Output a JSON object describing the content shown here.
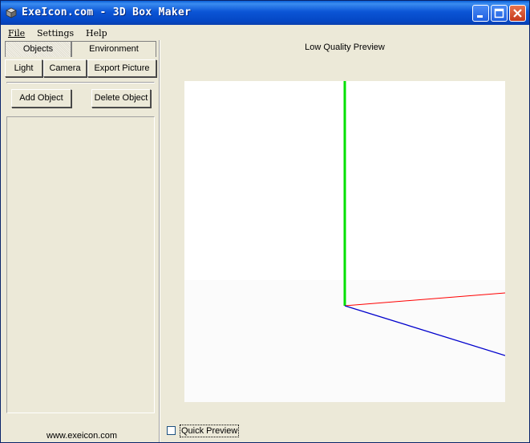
{
  "window": {
    "title": "ExeIcon.com - 3D Box Maker"
  },
  "menu": {
    "file": "File",
    "settings": "Settings",
    "help": "Help"
  },
  "tabs": {
    "objects": "Objects",
    "environment": "Environment"
  },
  "subtabs": {
    "light": "Light",
    "camera": "Camera",
    "export": "Export Picture"
  },
  "objects_panel": {
    "add": "Add Object",
    "delete": "Delete Object"
  },
  "preview": {
    "title": "Low Quality Preview",
    "axis_colors": {
      "y": "#00e000",
      "x": "#ff0000",
      "z": "#0000cc"
    }
  },
  "quick_preview": {
    "label": "Quick Preview",
    "checked": false
  },
  "footer": {
    "link": "www.exeicon.com"
  }
}
